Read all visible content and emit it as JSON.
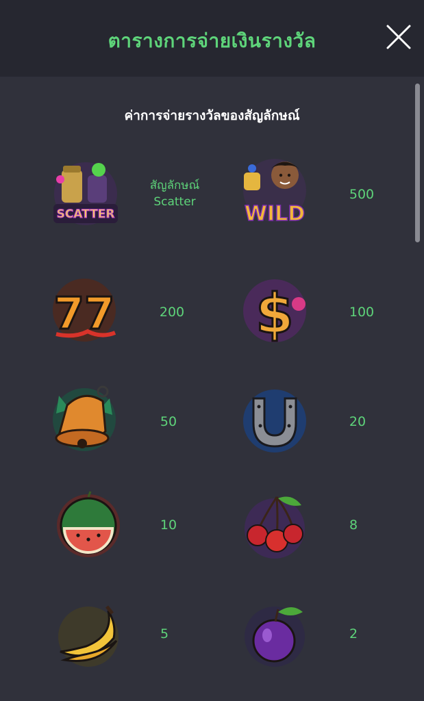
{
  "header": {
    "title": "ตารางการจ่ายเงินรางวัล",
    "close_icon": "close-icon"
  },
  "section": {
    "title": "ค่าการจ่ายรางวัลของสัญลักษณ์"
  },
  "symbols": [
    {
      "name": "scatter",
      "label_line1": "สัญลักษณ์",
      "label_line2": "Scatter",
      "image_text": "SCATTER"
    },
    {
      "name": "wild",
      "payout": "500",
      "image_text": "WILD"
    },
    {
      "name": "seven",
      "payout": "200",
      "image_text": "77"
    },
    {
      "name": "dollar",
      "payout": "100",
      "image_text": "$"
    },
    {
      "name": "bell",
      "payout": "50"
    },
    {
      "name": "horseshoe",
      "payout": "20"
    },
    {
      "name": "watermelon",
      "payout": "10"
    },
    {
      "name": "cherry",
      "payout": "8"
    },
    {
      "name": "banana",
      "payout": "5"
    },
    {
      "name": "plum",
      "payout": "2"
    }
  ],
  "colors": {
    "accent_green": "#5ed47a",
    "background": "#30313b",
    "header_bg": "#262730"
  }
}
